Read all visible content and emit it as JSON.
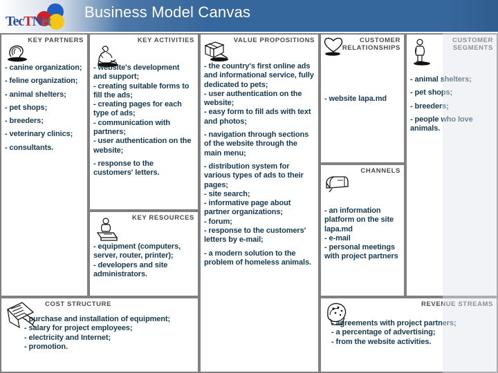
{
  "header": {
    "title": "Business Model Canvas",
    "logo": {
      "text_parts": [
        "Tec",
        "T",
        "N",
        "et"
      ],
      "full_text": "TecTNet",
      "colors": [
        "#2b4f9e",
        "#cc1f2a",
        "#f5c518"
      ]
    },
    "bar_color": "#36679c"
  },
  "canvas": {
    "key_partners": {
      "title": "KEY PARTNERS",
      "icon": "lightbulb-handshake-icon",
      "items": [
        "-      canine organization;",
        "-      feline organization;",
        "-      animal shelters;",
        "-      pet shops;",
        "-      breeders;",
        "- veterinary clinics;",
        "- consultants."
      ]
    },
    "key_activities": {
      "title": "KEY ACTIVITIES",
      "icon": "worker-person-icon",
      "items": [
        "- website's development and support;",
        "- creating suitable forms to fill the ads;",
        "- creating pages for each type of ads;",
        "- communication with partners;",
        "- user authentication on the website;",
        "- response to the customers' letters."
      ]
    },
    "key_resources": {
      "title": "KEY RESOURCES",
      "icon": "computer-person-icon",
      "items": [
        "- equipment (computers, server, router, printer);",
        "- developers and site administrators."
      ]
    },
    "value_propositions": {
      "title": "VALUE PROPOSITIONS",
      "icon": "gift-box-icon",
      "items": [
        "- the country's first online ads and informational service, fully dedicated to pets;",
        "- user authentication on the website;",
        "- easy form to fill ads with text and photos;",
        "- navigation through sections of the website through the main menu;",
        "- distribution system for various types of ads to their pages;",
        "- site search;",
        "- informative page about partner organizations;",
        "- forum;",
        "- response to the customers' letters by e-mail;",
        "- a modern solution to the problem of homeless animals."
      ]
    },
    "customer_relationships": {
      "title": "CUSTOMER RELATIONSHIPS",
      "icon": "heart-icon",
      "items": [
        "- website lapa.md"
      ]
    },
    "channels": {
      "title": "CHANNELS",
      "icon": "mailbox-icon",
      "items": [
        "- an information platform on the site lapa.md",
        "- e-mail",
        "- personal meetings with project partners"
      ]
    },
    "customer_segments": {
      "title": "CUSTOMER SEGMENTS",
      "icon": "standing-person-icon",
      "items": [
        "- animal shelters;",
        "-      pet shops;",
        "-      breeders;",
        "- people who love animals."
      ]
    },
    "cost_structure": {
      "title": "COST STRUCTURE",
      "icon": "notepad-pen-icon",
      "items": [
        "- purchase and installation of equipment;",
        "- salary for project employees;",
        "- electricity and Internet;",
        "- promotion."
      ]
    },
    "revenue_streams": {
      "title": "REVENUE STREAMS",
      "icon": "money-coins-icon",
      "items": [
        "- agreements with project partners;",
        "- a percentage of advertising;",
        "- from the website activities."
      ]
    }
  }
}
